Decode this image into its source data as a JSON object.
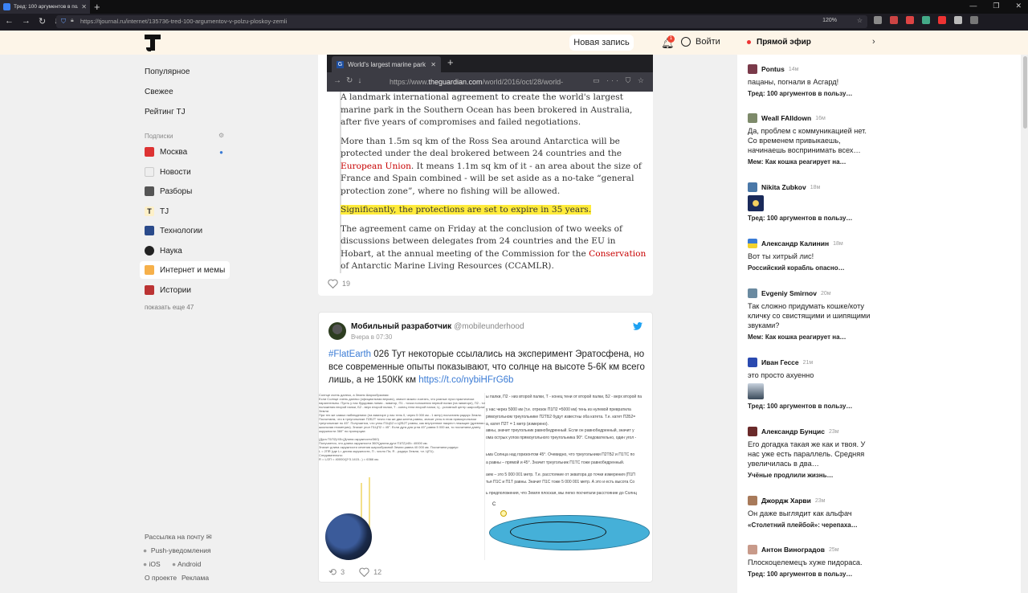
{
  "browser": {
    "tab_title": "Тред: 100 аргументов в польз...",
    "url": "https://tjournal.ru/internet/135736-tred-100-argumentov-v-polzu-ploskoy-zemli",
    "zoom": "120%"
  },
  "header": {
    "new_post": "Новая запись",
    "notifications_count": "1",
    "login": "Войти",
    "live": "Прямой эфир"
  },
  "sidebar": {
    "nav": [
      "Популярное",
      "Свежее",
      "Рейтинг TJ"
    ],
    "subscriptions_title": "Подписки",
    "subs": [
      "Москва",
      "Новости",
      "Разборы",
      "TJ",
      "Технологии",
      "Наука",
      "Интернет и мемы",
      "Истории"
    ],
    "show_more": "показать еще 47",
    "mail": "Рассылка на почту",
    "push": "Push-уведомления",
    "ios": "iOS",
    "android": "Android",
    "about": "О проекте",
    "ads": "Реклама"
  },
  "post1": {
    "shot_tab": "World's largest marine park c",
    "shot_url_pre": "https://www.",
    "shot_url_host": "theguardian.com",
    "shot_url_post": "/world/2016/oct/28/world-",
    "p1": "A landmark international agreement to create the world's largest marine park in the Southern Ocean has been brokered in Australia, after five years of compromises and failed negotiations.",
    "p2a": "More than 1.5m sq km of the Ross Sea around Antarctica will be protected under the deal brokered between 24 countries and the ",
    "p2link": "European Union",
    "p2b": ". It means 1.1m sq km of it - an area about the size of France and Spain combined - will be set aside as a no-take “general protection zone”, where no fishing will be allowed.",
    "p3": "Significantly, the protections are set to expire in 35 years.",
    "p4a": "The agreement came on Friday at the conclusion of two weeks of discussions between delegates from 24 countries and the EU in Hobart, at the annual meeting of the Commission for the ",
    "p4link": "Conservation",
    "p4b": " of Antarctic Marine Living Resources (CCAMLR).",
    "likes": "19"
  },
  "post2": {
    "author": "Мобильный разработчик",
    "handle": "@mobileunderhood",
    "date": "Вчера в 07:30",
    "hashtag": "#FlatEarth",
    "text": " 026 Тут некоторые ссылались на эксперимент Эратосфена, но все современные опыты показывают, что солнце на высоте 5-6К км всего лишь, а не 150КК км ",
    "link": "https://t.co/nybiHFrG6b",
    "retweets": "3",
    "likes": "12",
    "media_left_lines": [
      "Солнце очень далеко, а Земля Шарообразная:",
      "Если Солнце очень далеко (официальная версия), значит можно считать, что разные лучи практически",
      "параллельны. Пусть у нас бурдовая линия - экватор, П1 - точка положения первой палки (на экваторе), П2 - точка",
      "положения второй палки, Б2 - верх второй палки, Т - конец тени второй палки, Ц - условный центр шарообразной",
      "Земли.",
      "При тех же самых наблюдениях (на экваторе у нас тень 0, через 5 000 км - 1 метр) посчитаем радиус Земли.",
      "Посчитаем, что в треугольнике П2Б2Т точно так же два катета равны, значит углы в этом прямоугольном",
      "треугольнике по 45°. Получается, что углы П1ЦБ2 и Ц2Б2Т равны, как внутренние накрест лежащие (древняя вся",
      "школьная геометрия). Значит угол П1ЦП2 = 45°. Если дуга для угла 45° равна 5 000 км, то посчитаем длину",
      "окружности 360° по пропорции:",
      "",
      "(Дуга П1П2)/45=(Длина окружности/360)",
      "Получается, что длина окружности 360*(длина дуги П1П2)/45= 40000 км.",
      "Значит длина окружности сечения шарообразной Земли равна 40 000 км. Посчитаем радиус:",
      "L = 2ПR (где L= длина окружности, П - число Пи, R - радиус Земли, т.е. ЦП1).",
      "Следовательно:",
      "R = L/2П = 40000/(2*3.1415...) = 6366 км."
    ],
    "media_right_lines": [
      "ы палки, П2 - низ второй палки, Т - конец тени от второй палки, Б2 - верх второй па",
      "у нас через 5000 км (т.е. отрезок П1П2 =5000 км) тень из нулевой превратила",
      "рямоугольном треугольнике П2ТБ2 будут известны оба катета. Т.е. катет П2Б2=",
      "а, катет П2Т = 1 метр (измерено).",
      "авны, значит треугольник равнобедренный. Если он равнобедренный, значит у",
      "ома острых углов прямоугольного треугольника 90°. Следовательно, один угол -",
      "ьма Солнца над горизонтом 45°. Очевидно, что треугольники П2ТБ2 и П1ТС по",
      "а равны – прямой и 45°. Значит треугольник П1ТС тоже равнобедренный.",
      "аем – это 5 000 001 метр. Т.е. расстояние от экватора до точки измерения (П1П",
      "тья П1С и П1Т равны. Значит П1С тоже 5 000 001 метр. А это и есть высота Со",
      "ь предположения, что Земля плоская, мы легко посчитали расстояние до Солнц"
    ]
  },
  "live": [
    {
      "name": "Pontus",
      "time": "14м",
      "text": "пацаны, погнали в Асгард!",
      "topic": "Тред: 100 аргументов в пользу…"
    },
    {
      "name": "Weall FAlldown",
      "time": "16м",
      "text": "Да, проблем с коммуникацией нет. Со временем привыкаешь, начинаешь воспринимать всех…",
      "topic": "Мем: Как кошка реагирует на…"
    },
    {
      "name": "Nikita Zubkov",
      "time": "18м",
      "text": "",
      "topic": "Тред: 100 аргументов в пользу…"
    },
    {
      "name": "Александр Калинин",
      "time": "18м",
      "text": "Вот ты хитрый лис!",
      "topic": "Российский корабль опасно…"
    },
    {
      "name": "Evgeniy Smirnov",
      "time": "20м",
      "text": "Так сложно придумать кошке/коту кличку со свистящими и шипящими звуками?",
      "topic": "Мем: Как кошка реагирует на…"
    },
    {
      "name": "Иван Гессе",
      "time": "21м",
      "text": "это просто ахуенно",
      "topic": "Тред: 100 аргументов в пользу…"
    },
    {
      "name": "Александр Бунцис",
      "time": "23м",
      "text": "Его догадка такая же как и твоя. У нас уже есть параллель. Средняя увеличилась в два…",
      "topic": "Учёные продлили жизнь…"
    },
    {
      "name": "Джордж Харви",
      "time": "23м",
      "text": "Он даже выглядит как альфач",
      "topic": "«Столетний плейбой»: черепаха…"
    },
    {
      "name": "Антон Виноградов",
      "time": "25м",
      "text": "Плоскоцелемецъ хуже пидораса.",
      "topic": "Тред: 100 аргументов в пользу…"
    }
  ],
  "colors": {
    "header_bg": "#fdf5e8",
    "accent_blue": "#3a7bd5",
    "highlight": "#ffeb3b",
    "guardian_red": "#c70000",
    "live_dot": "#e33"
  }
}
